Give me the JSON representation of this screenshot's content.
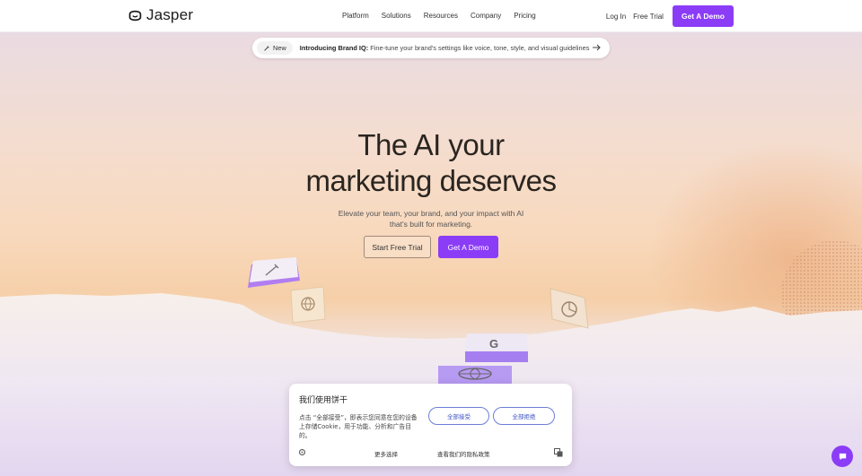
{
  "brand": {
    "name": "Jasper",
    "accent": "#8b3cf7"
  },
  "nav": {
    "links": [
      "Platform",
      "Solutions",
      "Resources",
      "Company",
      "Pricing"
    ],
    "login": "Log In",
    "free_trial": "Free Trial",
    "demo": "Get A Demo"
  },
  "announcement": {
    "badge": "New",
    "title": "Introducing Brand IQ:",
    "text": "Fine-tune your brand's settings like voice, tone, style, and visual guidelines",
    "arrow_icon": "arrow-right-icon"
  },
  "hero": {
    "headline_line1": "The AI your",
    "headline_line2": "marketing deserves",
    "sub_line1": "Elevate your team, your brand, and your impact with AI",
    "sub_line2": "that's built for marketing.",
    "cta_trial": "Start Free Trial",
    "cta_demo": "Get A Demo"
  },
  "cookie": {
    "title": "我们使用饼干",
    "text": "点击 “全部接受”，即表示您同意在您的设备上存储Cookie，用于功能、分析和广告目的。",
    "accept_all": "全部接受",
    "reject_all": "全部拒绝",
    "more_options": "更多选择",
    "privacy_policy": "查看我们的隐私政策"
  }
}
